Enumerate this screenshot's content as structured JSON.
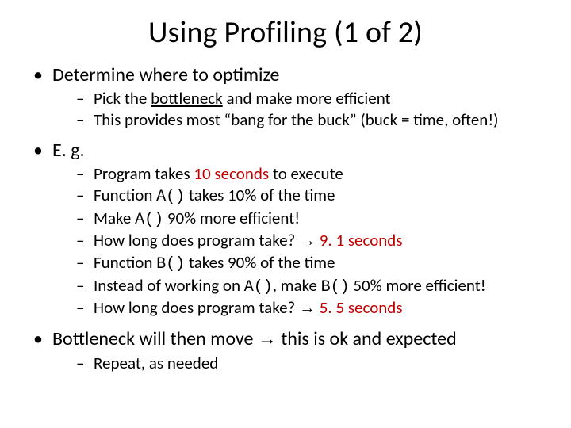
{
  "title": "Using Profiling (1 of 2)",
  "b1": {
    "text": "Determine where to optimize"
  },
  "b1a": {
    "pre": "Pick the ",
    "u": "bottleneck",
    "post": " and make more efficient"
  },
  "b1b": {
    "text": "This provides most “bang for the buck” (buck = time, often!)"
  },
  "b2": {
    "text": "E. g."
  },
  "e1": {
    "pre": "Program takes ",
    "red": "10 seconds",
    "post": " to execute"
  },
  "e2": {
    "pre": "Function ",
    "code": "A()",
    "post": "  takes 10% of the time"
  },
  "e3": {
    "pre": "Make ",
    "code": "A()",
    "post": " 90% more efficient!"
  },
  "e4": {
    "pre": "How long does program take? ",
    "arrow": "→",
    "red": " 9. 1 seconds"
  },
  "e5": {
    "pre": "Function ",
    "code": "B()",
    "post": " takes 90% of the time"
  },
  "e6": {
    "pre": "Instead of working on ",
    "code1": "A()",
    "mid": ", make ",
    "code2": "B()",
    "post": " 50% more efficient!"
  },
  "e7": {
    "pre": "How long does program take? ",
    "arrow": "→",
    "red": " 5. 5 seconds"
  },
  "b3": {
    "pre": "Bottleneck will then move ",
    "arrow": "→",
    "post": " this is ok and expected"
  },
  "b3a": {
    "text": "Repeat, as needed"
  }
}
